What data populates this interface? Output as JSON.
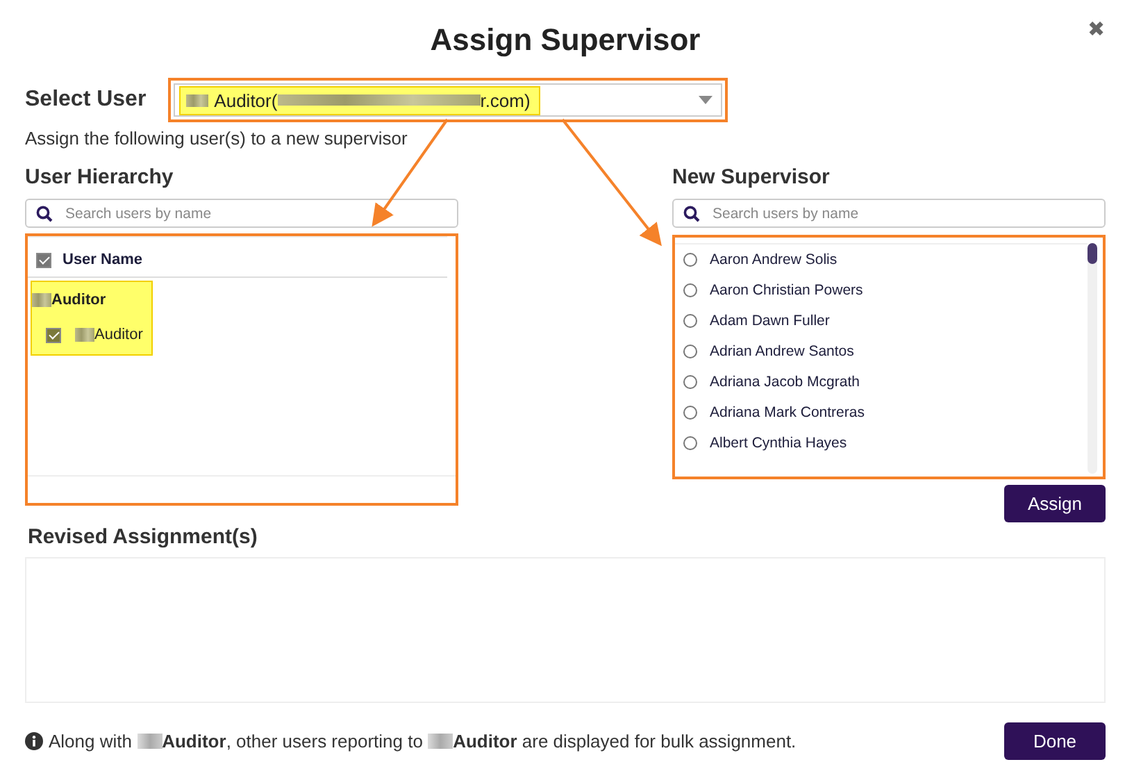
{
  "dialog": {
    "title": "Assign Supervisor",
    "close": "✖"
  },
  "select_user": {
    "label": "Select User",
    "value_start": "Auditor(",
    "value_end": "r.com)",
    "highlighted": true
  },
  "instruction": "Assign the following user(s) to a new supervisor",
  "hierarchy": {
    "title": "User Hierarchy",
    "search": {
      "placeholder": "Search users by name"
    },
    "header": {
      "label": "User Name",
      "checked": true
    },
    "tree": [
      {
        "name": "Auditor",
        "children": [
          {
            "name": "Auditor",
            "checked": true
          }
        ]
      }
    ]
  },
  "new_supervisor": {
    "title": "New Supervisor",
    "search": {
      "placeholder": "Search users by name"
    },
    "options": [
      {
        "name": "Aaron Andrew Solis",
        "selected": false
      },
      {
        "name": "Aaron Christian Powers",
        "selected": false
      },
      {
        "name": "Adam Dawn Fuller",
        "selected": false
      },
      {
        "name": "Adrian Andrew Santos",
        "selected": false
      },
      {
        "name": "Adriana Jacob Mcgrath",
        "selected": false
      },
      {
        "name": "Adriana Mark Contreras",
        "selected": false
      },
      {
        "name": "Albert Cynthia Hayes",
        "selected": false
      }
    ],
    "assign_button": "Assign"
  },
  "revised": {
    "title": "Revised Assignment(s)"
  },
  "note": {
    "parts": [
      {
        "kind": "text",
        "text": "Along with "
      },
      {
        "kind": "redacted"
      },
      {
        "kind": "text",
        "text": "**Auditor**, other users reporting to "
      },
      {
        "kind": "redacted"
      },
      {
        "kind": "text",
        "text": "**Auditor** are displayed for bulk assignment."
      }
    ]
  },
  "done_button": "Done"
}
